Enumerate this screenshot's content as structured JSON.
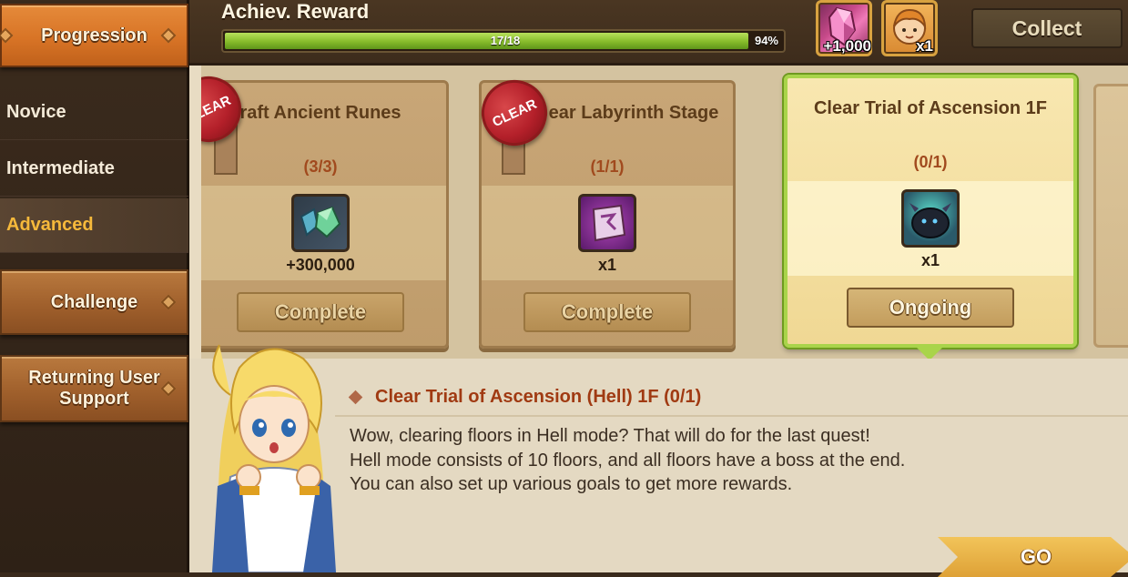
{
  "sidebar": {
    "progression_label": "Progression",
    "sub_items": [
      "Novice",
      "Intermediate",
      "Advanced"
    ],
    "selected_sub_item": "Advanced",
    "challenge_label": "Challenge",
    "returning_label_line1": "Returning User",
    "returning_label_line2": "Support"
  },
  "header": {
    "title": "Achiev. Reward",
    "progress_text": "17/18",
    "progress_percent_label": "94%",
    "progress_fraction": 0.94,
    "rewards": [
      {
        "icon": "crystal-icon",
        "quantity": "+1,000"
      },
      {
        "icon": "hero-portrait-icon",
        "quantity": "x1"
      }
    ],
    "collect_label": "Collect"
  },
  "cards": [
    {
      "title": "raft Ancient Runes",
      "count": "(3/3)",
      "item_icon": "gem-stones-icon",
      "amount": "+300,000",
      "button": "Complete",
      "seal": "CLEAR"
    },
    {
      "title": "ear Labyrinth Stage",
      "count": "(1/1)",
      "item_icon": "rune-scroll-icon",
      "amount": "x1",
      "button": "Complete",
      "seal": "CLEAR"
    },
    {
      "title": "Clear Trial of Ascension 1F",
      "count": "(0/1)",
      "item_icon": "dark-slime-icon",
      "amount": "x1",
      "button": "Ongoing"
    }
  ],
  "description": {
    "heading": "Clear Trial of Ascension (Hell) 1F (0/1)",
    "line1": "Wow, clearing floors in Hell mode? That will do for the last quest!",
    "line2": "Hell mode consists of 10 floors, and all floors have a boss at the end.",
    "line3": "You can also set up various goals to get more rewards."
  },
  "go_label": "GO",
  "colors": {
    "progress_green": "#86bb2a",
    "seal_red": "#b4202a",
    "active_tab_orange": "#d87426",
    "selected_sub_text": "#f6b93b",
    "heading_text": "#a03a12"
  }
}
